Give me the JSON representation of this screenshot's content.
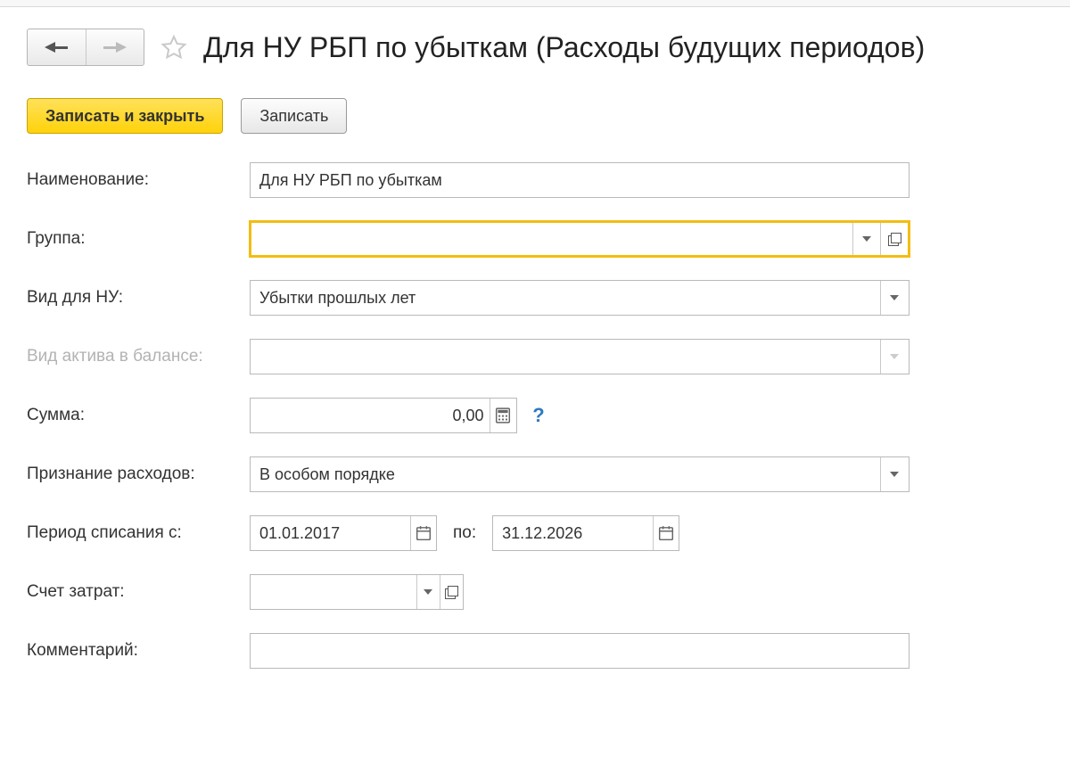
{
  "header": {
    "title": "Для НУ РБП по убыткам (Расходы будущих периодов)"
  },
  "toolbar": {
    "save_close": "Записать и закрыть",
    "save": "Записать"
  },
  "labels": {
    "name": "Наименование:",
    "group": "Группа:",
    "nu_type": "Вид для НУ:",
    "asset_type": "Вид актива в балансе:",
    "amount": "Сумма:",
    "recognition": "Признание расходов:",
    "period_from": "Период списания с:",
    "period_to": "по:",
    "cost_account": "Счет затрат:",
    "comment": "Комментарий:"
  },
  "values": {
    "name": "Для НУ РБП по убыткам",
    "group": "",
    "nu_type": "Убытки прошлых лет",
    "asset_type": "",
    "amount": "0,00",
    "recognition": "В особом порядке",
    "period_from": "01.01.2017",
    "period_to": "31.12.2026",
    "cost_account": "",
    "comment": ""
  },
  "help_char": "?"
}
